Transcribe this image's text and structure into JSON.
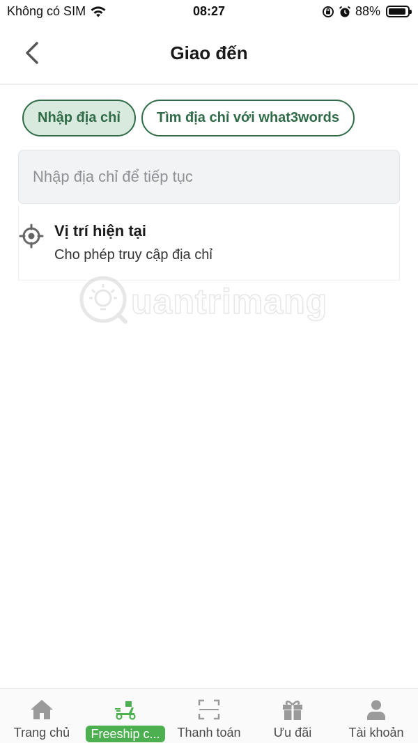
{
  "status_bar": {
    "carrier": "Không có SIM",
    "time": "08:27",
    "battery": "88%"
  },
  "header": {
    "title": "Giao đến"
  },
  "tabs": [
    {
      "label": "Nhập địa chỉ",
      "active": true
    },
    {
      "label": "Tìm địa chỉ với what3words",
      "active": false
    }
  ],
  "search": {
    "placeholder": "Nhập địa chỉ để tiếp tục",
    "value": ""
  },
  "current_location": {
    "title": "Vị trí hiện tại",
    "subtitle": "Cho phép truy cập địa chỉ"
  },
  "watermark": {
    "text": "uantrimang"
  },
  "bottom_nav": [
    {
      "label": "Trang chủ",
      "icon": "home-icon",
      "active": false
    },
    {
      "label": "Freeship c...",
      "icon": "delivery-scooter-icon",
      "active": true
    },
    {
      "label": "Thanh toán",
      "icon": "scan-icon",
      "active": false
    },
    {
      "label": "Ưu đãi",
      "icon": "gift-icon",
      "active": false
    },
    {
      "label": "Tài khoản",
      "icon": "user-icon",
      "active": false
    }
  ],
  "colors": {
    "brand_green": "#2f6b47",
    "active_tab_bg": "#d7eadd",
    "nav_active": "#4caf50",
    "nav_icon": "#9a9a9a"
  }
}
